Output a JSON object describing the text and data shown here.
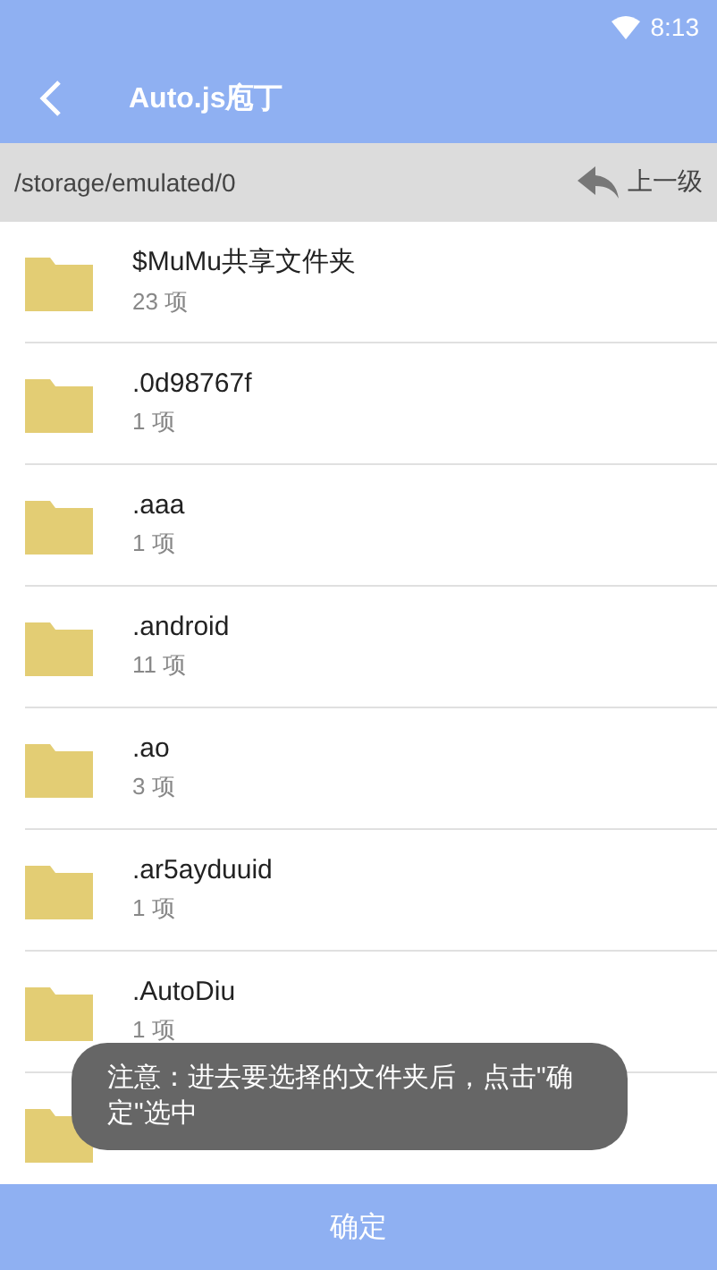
{
  "status_bar": {
    "time": "8:13"
  },
  "app_bar": {
    "title": "Auto.js庖丁"
  },
  "path_bar": {
    "path": "/storage/emulated/0",
    "up_label": "上一级"
  },
  "folders": [
    {
      "kind": "folder",
      "name": "$MuMu共享文件夹",
      "count": "23 项"
    },
    {
      "kind": "folder",
      "name": ".0d98767f",
      "count": "1 项"
    },
    {
      "kind": "folder",
      "name": ".aaa",
      "count": "1 项"
    },
    {
      "kind": "folder",
      "name": ".android",
      "count": "11 项"
    },
    {
      "kind": "folder",
      "name": ".ao",
      "count": "3 项"
    },
    {
      "kind": "folder",
      "name": ".ar5ayduuid",
      "count": "1 项"
    },
    {
      "kind": "folder",
      "name": ".AutoDiu",
      "count": "1 项"
    },
    {
      "kind": "covered"
    }
  ],
  "toast": {
    "text": "注意：进去要选择的文件夹后，点击\"确定\"选中"
  },
  "confirm_button": {
    "label": "确定"
  }
}
